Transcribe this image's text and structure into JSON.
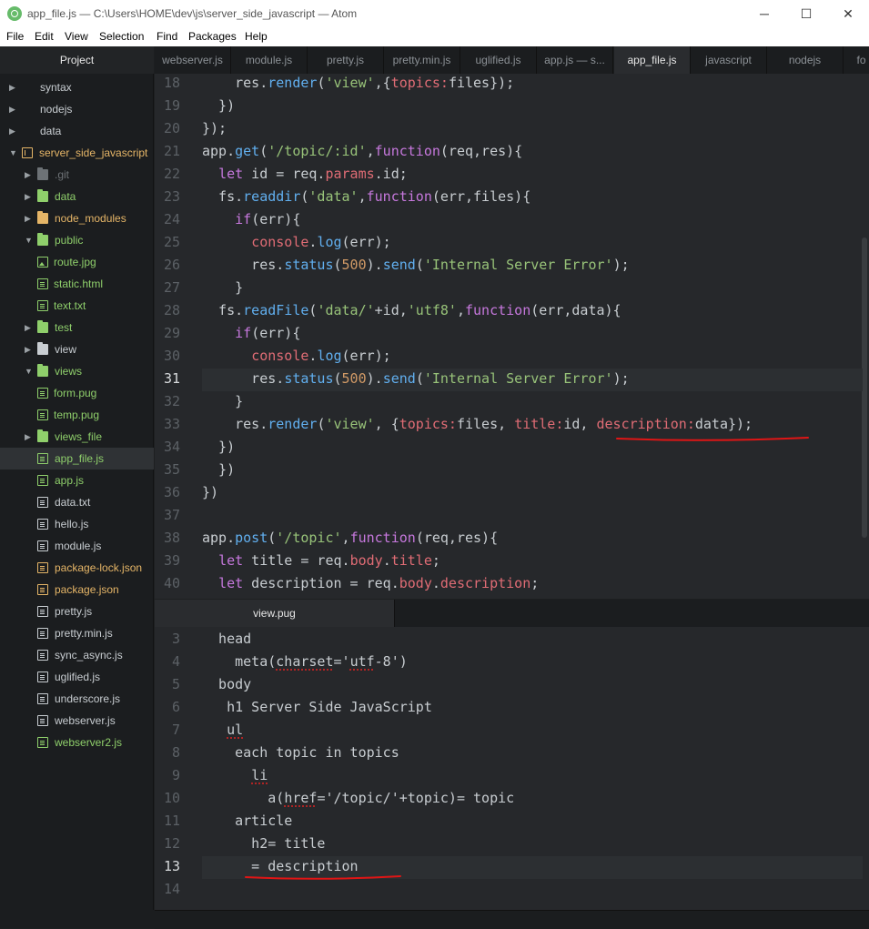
{
  "window": {
    "title": "app_file.js — C:\\Users\\HOME\\dev\\js\\server_side_javascript — Atom",
    "minimize": "─",
    "maximize": "☐",
    "close": "✕"
  },
  "menu": [
    "File",
    "Edit",
    "View",
    "Selection",
    "Find",
    "Packages",
    "Help"
  ],
  "sidebar": {
    "title": "Project",
    "items": [
      {
        "label": "syntax",
        "type": "folder",
        "expanded": false,
        "color": "#c8cdd1"
      },
      {
        "label": "nodejs",
        "type": "folder",
        "expanded": false,
        "color": "#c8cdd1"
      },
      {
        "label": "data",
        "type": "folder",
        "expanded": false,
        "color": "#c8cdd1"
      },
      {
        "label": "server_side_javascript",
        "type": "repo",
        "expanded": true,
        "color": "#e5b567"
      },
      {
        "label": ".git",
        "type": "folder",
        "expanded": false,
        "color": "#6d7276"
      },
      {
        "label": "data",
        "type": "folder",
        "expanded": false,
        "color": "#8fcf6b"
      },
      {
        "label": "node_modules",
        "type": "folder",
        "expanded": false,
        "color": "#e5b567"
      },
      {
        "label": "public",
        "type": "folder",
        "expanded": true,
        "color": "#8fcf6b"
      },
      {
        "label": "route.jpg",
        "type": "image",
        "color": "#8fcf6b"
      },
      {
        "label": "static.html",
        "type": "file",
        "color": "#8fcf6b"
      },
      {
        "label": "text.txt",
        "type": "file",
        "color": "#8fcf6b"
      },
      {
        "label": "test",
        "type": "folder",
        "expanded": false,
        "color": "#8fcf6b"
      },
      {
        "label": "view",
        "type": "folder",
        "expanded": false,
        "color": "#c8cdd1"
      },
      {
        "label": "views",
        "type": "folder",
        "expanded": true,
        "color": "#8fcf6b"
      },
      {
        "label": "form.pug",
        "type": "file",
        "color": "#8fcf6b"
      },
      {
        "label": "temp.pug",
        "type": "file",
        "color": "#8fcf6b"
      },
      {
        "label": "views_file",
        "type": "folder",
        "expanded": false,
        "color": "#8fcf6b"
      },
      {
        "label": "app_file.js",
        "type": "file",
        "color": "#8fcf6b",
        "selected": true
      },
      {
        "label": "app.js",
        "type": "file",
        "color": "#8fcf6b"
      },
      {
        "label": "data.txt",
        "type": "file",
        "color": "#c8cdd1"
      },
      {
        "label": "hello.js",
        "type": "file",
        "color": "#c8cdd1"
      },
      {
        "label": "module.js",
        "type": "file",
        "color": "#c8cdd1"
      },
      {
        "label": "package-lock.json",
        "type": "file",
        "color": "#e5b567"
      },
      {
        "label": "package.json",
        "type": "file",
        "color": "#e5b567"
      },
      {
        "label": "pretty.js",
        "type": "file",
        "color": "#c8cdd1"
      },
      {
        "label": "pretty.min.js",
        "type": "file",
        "color": "#c8cdd1"
      },
      {
        "label": "sync_async.js",
        "type": "file",
        "color": "#c8cdd1"
      },
      {
        "label": "uglified.js",
        "type": "file",
        "color": "#c8cdd1"
      },
      {
        "label": "underscore.js",
        "type": "file",
        "color": "#c8cdd1"
      },
      {
        "label": "webserver.js",
        "type": "file",
        "color": "#c8cdd1"
      },
      {
        "label": "webserver2.js",
        "type": "file",
        "color": "#8fcf6b"
      }
    ]
  },
  "tabs": [
    "webserver.js",
    "module.js",
    "pretty.js",
    "pretty.min.js",
    "uglified.js",
    "app.js — s...",
    "app_file.js",
    "javascript",
    "nodejs",
    "fo"
  ],
  "active_tab": "app_file.js",
  "editor1": {
    "current_line": "31",
    "lines": [
      {
        "num": "18",
        "code": "    res.render('view',{topics:files});"
      },
      {
        "num": "19",
        "code": "  })"
      },
      {
        "num": "20",
        "code": "});"
      },
      {
        "num": "21",
        "code": "app.get('/topic/:id',function(req,res){"
      },
      {
        "num": "22",
        "code": "  let id = req.params.id;"
      },
      {
        "num": "23",
        "code": "  fs.readdir('data',function(err,files){"
      },
      {
        "num": "24",
        "code": "    if(err){"
      },
      {
        "num": "25",
        "code": "      console.log(err);"
      },
      {
        "num": "26",
        "code": "      res.status(500).send('Internal Server Error');"
      },
      {
        "num": "27",
        "code": "    }"
      },
      {
        "num": "28",
        "code": "  fs.readFile('data/'+id,'utf8',function(err,data){"
      },
      {
        "num": "29",
        "code": "    if(err){"
      },
      {
        "num": "30",
        "code": "      console.log(err);"
      },
      {
        "num": "31",
        "code": "      res.status(500).send('Internal Server Error');"
      },
      {
        "num": "32",
        "code": "    }"
      },
      {
        "num": "33",
        "code": "    res.render('view', {topics:files, title:id, description:data});"
      },
      {
        "num": "34",
        "code": "  })"
      },
      {
        "num": "35",
        "code": "  })"
      },
      {
        "num": "36",
        "code": "})"
      },
      {
        "num": "37",
        "code": ""
      },
      {
        "num": "38",
        "code": "app.post('/topic',function(req,res){"
      },
      {
        "num": "39",
        "code": "  let title = req.body.title;"
      },
      {
        "num": "40",
        "code": "  let description = req.body.description;"
      }
    ]
  },
  "editor2": {
    "tab": "view.pug",
    "current_line": "13",
    "lines": [
      {
        "num": "3",
        "code": "  head"
      },
      {
        "num": "4",
        "code": "    meta(charset='utf-8')"
      },
      {
        "num": "5",
        "code": "  body"
      },
      {
        "num": "6",
        "code": "   h1 Server Side JavaScript"
      },
      {
        "num": "7",
        "code": "   ul"
      },
      {
        "num": "8",
        "code": "    each topic in topics"
      },
      {
        "num": "9",
        "code": "      li"
      },
      {
        "num": "10",
        "code": "        a(href='/topic/'+topic)= topic"
      },
      {
        "num": "11",
        "code": "    article"
      },
      {
        "num": "12",
        "code": "      h2= title"
      },
      {
        "num": "13",
        "code": "      = description"
      },
      {
        "num": "14",
        "code": ""
      }
    ]
  },
  "colors": {
    "annotation": "#e01515",
    "accent": "#8fcf6b"
  }
}
